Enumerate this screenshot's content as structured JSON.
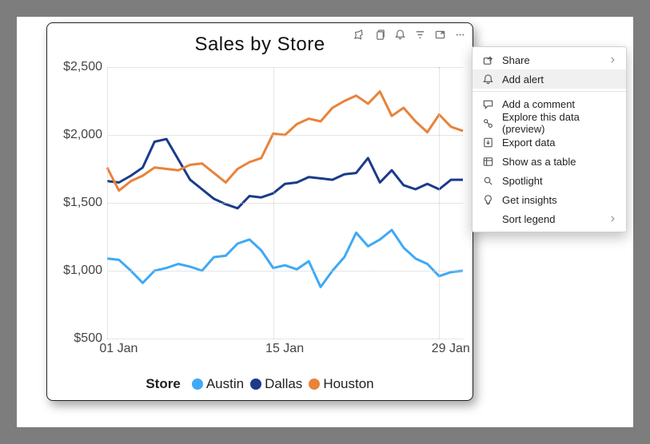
{
  "title": "Sales by Store",
  "y_ticks": [
    "$2,500",
    "$2,000",
    "$1,500",
    "$1,000",
    "$500"
  ],
  "x_ticks": [
    "01 Jan",
    "15 Jan",
    "29 Jan"
  ],
  "legend_title": "Store",
  "series_names": [
    "Austin",
    "Dallas",
    "Houston"
  ],
  "colors": {
    "austin": "#3fa9f5",
    "dallas": "#1b3b8b",
    "houston": "#e8833a"
  },
  "toolbar_icons": [
    "pin-icon",
    "copy-icon",
    "bell-icon",
    "filter-icon",
    "focus-icon",
    "more-icon"
  ],
  "menu": [
    {
      "icon": "share-icon",
      "label": "Share",
      "chevron": true
    },
    {
      "icon": "bell-icon",
      "label": "Add alert",
      "highlight": true
    },
    {
      "sep": true
    },
    {
      "icon": "comment-icon",
      "label": "Add a comment"
    },
    {
      "icon": "explore-icon",
      "label": "Explore this data (preview)"
    },
    {
      "icon": "export-icon",
      "label": "Export data"
    },
    {
      "icon": "table-icon",
      "label": "Show as a table"
    },
    {
      "icon": "spotlight-icon",
      "label": "Spotlight"
    },
    {
      "icon": "insights-icon",
      "label": "Get insights"
    },
    {
      "icon": "",
      "label": "Sort legend",
      "chevron": true
    }
  ],
  "chart_data": {
    "type": "line",
    "title": "Sales by Store",
    "xlabel": "",
    "ylabel": "",
    "ylim": [
      500,
      2500
    ],
    "x": [
      "01 Jan",
      "02 Jan",
      "03 Jan",
      "04 Jan",
      "05 Jan",
      "06 Jan",
      "07 Jan",
      "08 Jan",
      "09 Jan",
      "10 Jan",
      "11 Jan",
      "12 Jan",
      "13 Jan",
      "14 Jan",
      "15 Jan",
      "16 Jan",
      "17 Jan",
      "18 Jan",
      "19 Jan",
      "20 Jan",
      "21 Jan",
      "22 Jan",
      "23 Jan",
      "24 Jan",
      "25 Jan",
      "26 Jan",
      "27 Jan",
      "28 Jan",
      "29 Jan",
      "30 Jan",
      "31 Jan"
    ],
    "series": [
      {
        "name": "Austin",
        "color": "#3fa9f5",
        "values": [
          1090,
          1080,
          1000,
          910,
          1000,
          1020,
          1050,
          1030,
          1000,
          1100,
          1110,
          1200,
          1230,
          1150,
          1020,
          1040,
          1010,
          1070,
          880,
          1000,
          1100,
          1280,
          1180,
          1230,
          1300,
          1170,
          1090,
          1050,
          960,
          990,
          1000
        ]
      },
      {
        "name": "Dallas",
        "color": "#1b3b8b",
        "values": [
          1660,
          1650,
          1700,
          1760,
          1950,
          1970,
          1820,
          1670,
          1600,
          1530,
          1490,
          1460,
          1550,
          1540,
          1570,
          1640,
          1650,
          1690,
          1680,
          1670,
          1710,
          1720,
          1830,
          1650,
          1740,
          1630,
          1600,
          1640,
          1600,
          1670,
          1670
        ]
      },
      {
        "name": "Houston",
        "color": "#e8833a",
        "values": [
          1760,
          1590,
          1660,
          1700,
          1760,
          1750,
          1740,
          1780,
          1790,
          1720,
          1650,
          1750,
          1800,
          1830,
          2010,
          2000,
          2080,
          2120,
          2100,
          2200,
          2250,
          2290,
          2230,
          2320,
          2140,
          2200,
          2100,
          2020,
          2150,
          2060,
          2030
        ]
      }
    ],
    "legend": {
      "title": "Store",
      "position": "bottom"
    }
  }
}
